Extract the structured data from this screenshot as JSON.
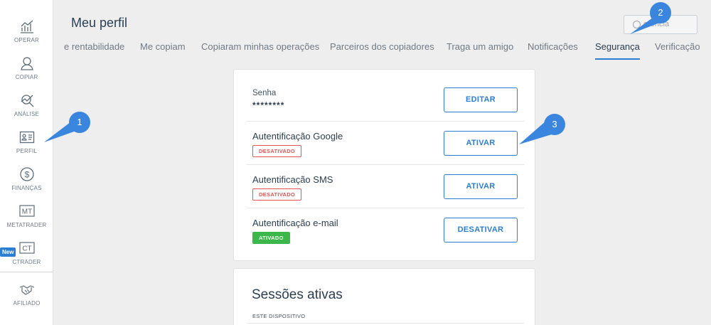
{
  "sidebar": {
    "items": [
      {
        "label": "OPERAR",
        "icon": "chart-icon"
      },
      {
        "label": "COPIAR",
        "icon": "person-icon"
      },
      {
        "label": "ANÁLISE",
        "icon": "analysis-icon"
      },
      {
        "label": "PERFIL",
        "icon": "id-card-icon"
      },
      {
        "label": "FINANÇAS",
        "icon": "dollar-icon"
      },
      {
        "label": "METATRADER",
        "icon": "mt-icon",
        "mark": "MT"
      },
      {
        "label": "CTRADER",
        "icon": "ct-icon",
        "mark": "CT"
      },
      {
        "label": "AFILIADO",
        "icon": "handshake-icon"
      }
    ],
    "new_badge": "New"
  },
  "header": {
    "title": "Meu perfil",
    "ref_button": "erência"
  },
  "tabs": [
    {
      "label": "e rentabilidade"
    },
    {
      "label": "Me copiam"
    },
    {
      "label": "Copiaram minhas operações"
    },
    {
      "label": "Parceiros dos copiadores"
    },
    {
      "label": "Traga um amigo"
    },
    {
      "label": "Notificações"
    },
    {
      "label": "Segurança",
      "active": true
    },
    {
      "label": "Verificação"
    }
  ],
  "security": {
    "rows": [
      {
        "title": "Senha",
        "value": "********",
        "button": "EDITAR"
      },
      {
        "title": "Autentificação Google",
        "status": "DESATIVADO",
        "button": "ATIVAR"
      },
      {
        "title": "Autentificação SMS",
        "status": "DESATIVADO",
        "button": "ATIVAR"
      },
      {
        "title": "Autentificação e-mail",
        "status": "ATIVADO",
        "button": "DESATIVAR"
      }
    ]
  },
  "sessions": {
    "title": "Sessões ativas",
    "subtitle": "ESTE DISPOSITIVO"
  },
  "markers": [
    "1",
    "2",
    "3"
  ],
  "colors": {
    "accent": "#2a7fd4",
    "danger": "#e05656",
    "success": "#3cb84a",
    "marker": "#3a86df"
  }
}
